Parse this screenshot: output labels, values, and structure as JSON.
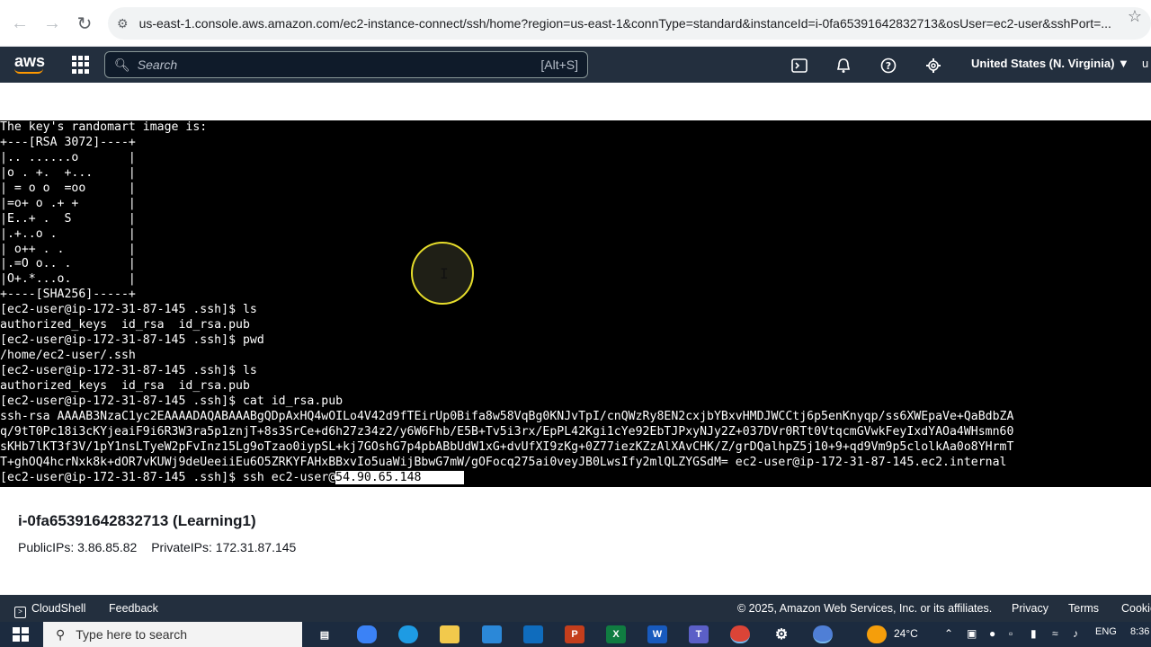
{
  "browser": {
    "url": "us-east-1.console.aws.amazon.com/ec2-instance-connect/ssh/home?region=us-east-1&connType=standard&instanceId=i-0fa65391642832713&osUser=ec2-user&sshPort=..."
  },
  "aws_nav": {
    "logo": "aws",
    "search_placeholder": "Search",
    "search_shortcut": "[Alt+S]",
    "region": "United States (N. Virginia) ▼",
    "account": "u"
  },
  "terminal": {
    "lines": [
      "The key's randomart image is:",
      "+---[RSA 3072]----+",
      "|.. ......o       |",
      "|o . +.  +...     |",
      "| = o o  =oo      |",
      "|=o+ o .+ +       |",
      "|E..+ .  S        |",
      "|.+..o .          |",
      "| o++ . .         |",
      "|.=O o.. .        |",
      "|O+.*...o.        |",
      "+----[SHA256]-----+",
      "[ec2-user@ip-172-31-87-145 .ssh]$ ls",
      "authorized_keys  id_rsa  id_rsa.pub",
      "[ec2-user@ip-172-31-87-145 .ssh]$ pwd",
      "/home/ec2-user/.ssh",
      "[ec2-user@ip-172-31-87-145 .ssh]$ ls",
      "authorized_keys  id_rsa  id_rsa.pub",
      "[ec2-user@ip-172-31-87-145 .ssh]$ cat id_rsa.pub",
      "ssh-rsa AAAAB3NzaC1yc2EAAAADAQABAAABgQDpAxHQ4wOILo4V42d9fTEirUp0Bifa8w58VqBg0KNJvTpI/cnQWzRy8EN2cxjbYBxvHMDJWCCtj6p5enKnyqp/ss6XWEpaVe+QaBdbZA",
      "q/9tT0Pc18i3cKYjeaiF9i6R3W3ra5p1znjT+8s3SrCe+d6h27z34z2/y6W6Fhb/E5B+Tv5i3rx/EpPL42Kgi1cYe92EbTJPxyNJy2Z+037DVr0RTt0VtqcmGVwkFeyIxdYAOa4WHsmn60",
      "sKHb7lKT3f3V/1pY1nsLTyeW2pFvInz15Lg9oTzao0iypSL+kj7GOshG7p4pbABbUdW1xG+dvUfXI9zKg+0Z77iezKZzAlXAvCHK/Z/grDQalhpZ5j10+9+qd9Vm9p5clolkAa0o8YHrmT",
      "T+ghOQ4hcrNxk8k+dOR7vKUWj9deUeeiiEu6O5ZRKYFAHxBBxvIo5uaWijBbwG7mW/gOFocq275ai0veyJB0LwsIfy2mlQLZYGSdM= ec2-user@ip-172-31-87-145.ec2.internal"
    ],
    "last_prompt": "[ec2-user@ip-172-31-87-145 .ssh]$ ssh ec2-user@",
    "selected_text": "54.90.65.148      "
  },
  "instance": {
    "title": "i-0fa65391642832713 (Learning1)",
    "public_ips": "PublicIPs: 3.86.85.82",
    "private_ips": "PrivateIPs: 172.31.87.145"
  },
  "footer": {
    "cloudshell": "CloudShell",
    "feedback": "Feedback",
    "copyright": "© 2025, Amazon Web Services, Inc. or its affiliates.",
    "privacy": "Privacy",
    "terms": "Terms",
    "cookie": "Cookie"
  },
  "taskbar": {
    "search_placeholder": "Type here to search",
    "weather": "24°C",
    "language": "ENG",
    "time": "8:36"
  },
  "colors": {
    "aws_nav_bg": "#232f3e",
    "terminal_bg": "#000000",
    "cursor_ring": "#e6dd2b"
  }
}
